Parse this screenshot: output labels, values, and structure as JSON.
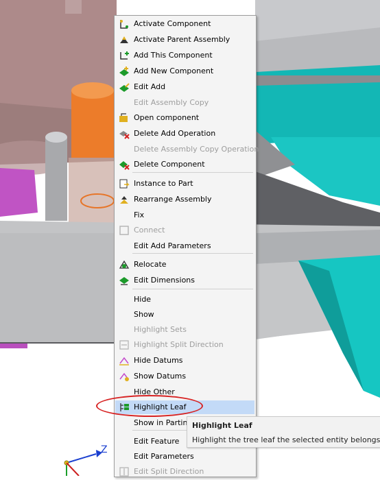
{
  "menu": {
    "items": [
      {
        "label": "Activate Component",
        "disabled": false,
        "icon": "activate-component-icon"
      },
      {
        "label": "Activate Parent Assembly",
        "disabled": false,
        "icon": "activate-parent-assembly-icon"
      },
      {
        "label": "Add This Component",
        "disabled": false,
        "icon": "add-this-component-icon"
      },
      {
        "label": "Add New Component",
        "disabled": false,
        "icon": "add-new-component-icon"
      },
      {
        "label": "Edit Add",
        "disabled": false,
        "icon": "edit-add-icon"
      },
      {
        "label": "Edit Assembly Copy",
        "disabled": true,
        "icon": ""
      },
      {
        "label": "Open component",
        "disabled": false,
        "icon": "open-component-icon"
      },
      {
        "label": "Delete Add Operation",
        "disabled": false,
        "icon": "delete-add-operation-icon"
      },
      {
        "label": "Delete Assembly Copy Operation",
        "disabled": true,
        "icon": ""
      },
      {
        "label": "Delete Component",
        "disabled": false,
        "icon": "delete-component-icon"
      },
      {
        "label": "Instance to Part",
        "disabled": false,
        "icon": "instance-to-part-icon"
      },
      {
        "label": "Rearrange Assembly",
        "disabled": false,
        "icon": "rearrange-assembly-icon"
      },
      {
        "label": "Fix",
        "disabled": false,
        "icon": ""
      },
      {
        "label": "Connect",
        "disabled": true,
        "icon": "connect-icon"
      },
      {
        "label": "Edit Add Parameters",
        "disabled": false,
        "icon": ""
      },
      {
        "label": "Relocate",
        "disabled": false,
        "icon": "relocate-icon"
      },
      {
        "label": "Edit Dimensions",
        "disabled": false,
        "icon": "edit-dimensions-icon"
      },
      {
        "label": "Hide",
        "disabled": false,
        "icon": ""
      },
      {
        "label": "Show",
        "disabled": false,
        "icon": ""
      },
      {
        "label": "Highlight Sets",
        "disabled": true,
        "icon": ""
      },
      {
        "label": "Highlight Split Direction",
        "disabled": true,
        "icon": "highlight-split-direction-icon"
      },
      {
        "label": "Hide Datums",
        "disabled": false,
        "icon": "hide-datums-icon"
      },
      {
        "label": "Show Datums",
        "disabled": false,
        "icon": "show-datums-icon"
      },
      {
        "label": "Hide Other",
        "disabled": false,
        "icon": ""
      },
      {
        "label": "Highlight Leaf",
        "disabled": false,
        "highlighted": true,
        "icon": "highlight-leaf-icon"
      },
      {
        "label": "Show in Parting",
        "disabled": false,
        "icon": ""
      },
      {
        "label": "Edit Feature",
        "disabled": false,
        "icon": ""
      },
      {
        "label": "Edit Parameters",
        "disabled": false,
        "icon": ""
      },
      {
        "label": "Edit Split Direction",
        "disabled": true,
        "icon": "edit-split-direction-icon"
      }
    ]
  },
  "tooltip": {
    "title": "Highlight Leaf",
    "body": "Highlight the tree leaf the selected entity belongs to"
  },
  "triad": {
    "z_label": "Z"
  },
  "colors": {
    "highlight": "#c3daf7",
    "annotation": "#d72222",
    "cyan_part": "#17c7c7",
    "orange_part": "#e8731f",
    "rose_part": "#a87a7a",
    "magenta_part": "#c454c6"
  }
}
